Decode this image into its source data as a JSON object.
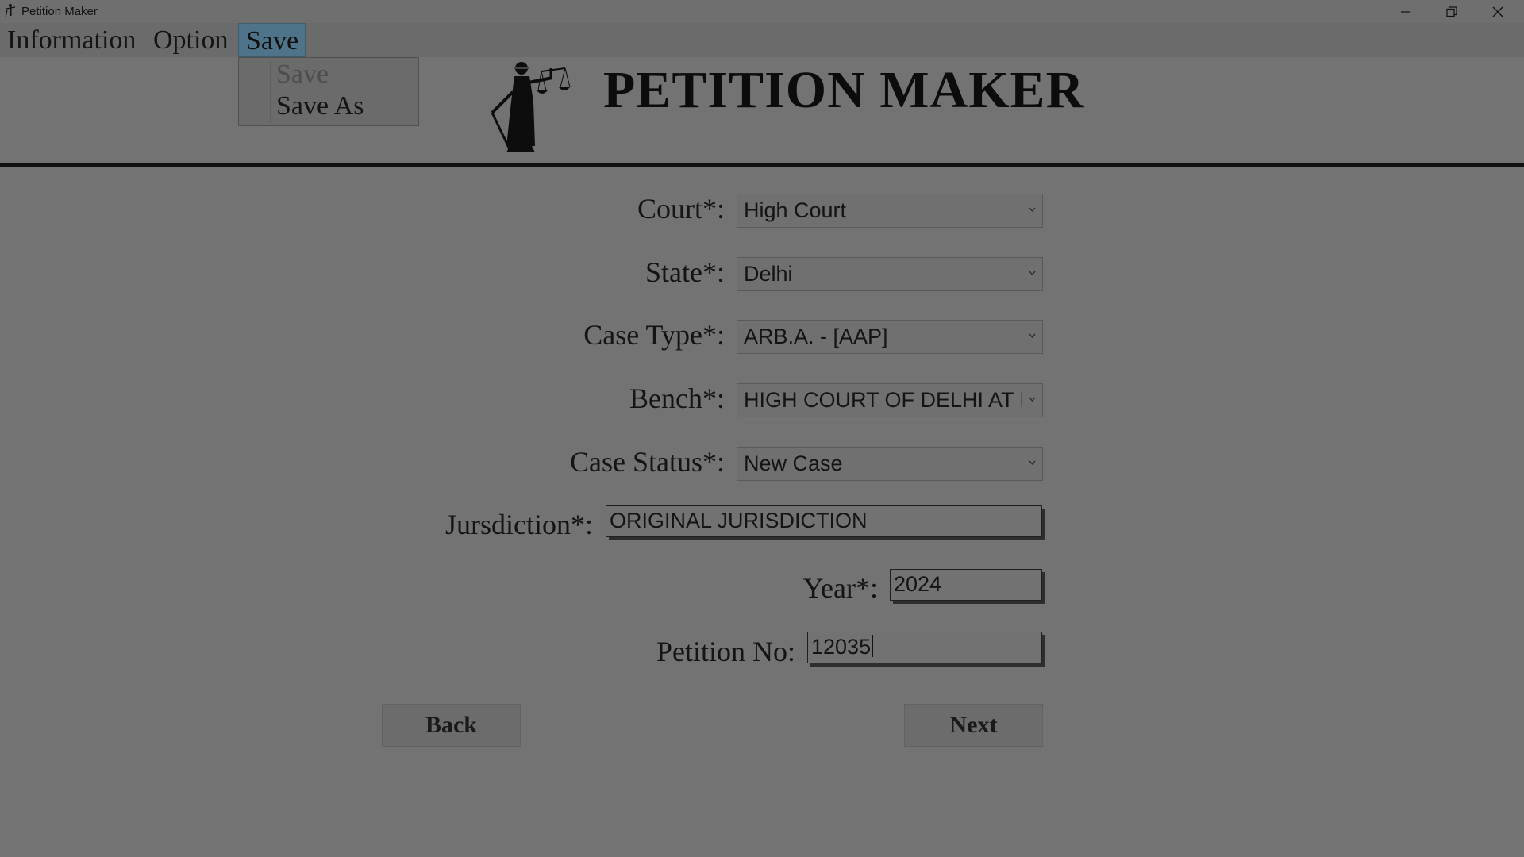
{
  "window": {
    "title": "Petition Maker",
    "icons": [
      "justice-icon",
      "minimize-icon",
      "restore-icon",
      "close-icon"
    ]
  },
  "menubar": {
    "items": [
      "Information",
      "Option",
      "Save"
    ],
    "active": "Save"
  },
  "save_menu": {
    "items": [
      {
        "label": "Save",
        "enabled": false
      },
      {
        "label": "Save As",
        "enabled": true
      }
    ]
  },
  "header": {
    "title": "PETITION MAKER",
    "logo": "lady-justice-icon"
  },
  "form": {
    "court": {
      "label": "Court*:",
      "value": "High Court"
    },
    "state": {
      "label": "State*:",
      "value": "Delhi"
    },
    "case_type": {
      "label": "Case Type*:",
      "value": "ARB.A. - [AAP]"
    },
    "bench": {
      "label": "Bench*:",
      "value": "HIGH COURT OF DELHI AT NEW DELHI"
    },
    "case_status": {
      "label": "Case Status*:",
      "value": "New Case"
    },
    "jurisdiction": {
      "label": "Jursdiction*:",
      "value": "ORIGINAL JURISDICTION"
    },
    "year": {
      "label": "Year*:",
      "value": "2024"
    },
    "petition_no": {
      "label": "Petition No:",
      "value": "12035"
    }
  },
  "buttons": {
    "back": "Back",
    "next": "Next"
  },
  "colors": {
    "overlay_background": "#737373",
    "menu_highlight": "#4f7489",
    "separator": "#111111"
  }
}
